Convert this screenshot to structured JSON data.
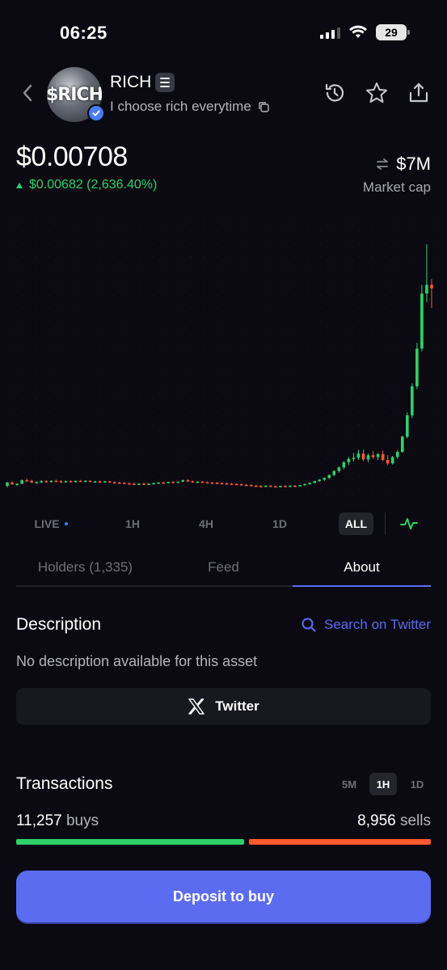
{
  "status_bar": {
    "time": "06:25",
    "battery": "29"
  },
  "header": {
    "avatar_text": "$RICH",
    "token_name": "RICH",
    "tagline": "I choose rich everytime",
    "icons": [
      "back-icon",
      "history-icon",
      "star-icon",
      "share-icon",
      "copy-icon",
      "verified-icon"
    ]
  },
  "price": {
    "value": "$0.00708",
    "change": "$0.00682 (2,636.40%)",
    "market_cap_value": "$7M",
    "market_cap_label": "Market cap"
  },
  "timeframes": {
    "items": [
      "LIVE",
      "1H",
      "4H",
      "1D",
      "ALL"
    ],
    "selected": "ALL"
  },
  "tabs": {
    "items": [
      "Holders (1,335)",
      "Feed",
      "About"
    ],
    "selected": "About"
  },
  "description": {
    "title": "Description",
    "search_label": "Search on Twitter",
    "text": "No description available for this asset",
    "twitter_label": "Twitter"
  },
  "transactions": {
    "title": "Transactions",
    "timeframes": [
      "5M",
      "1H",
      "1D"
    ],
    "selected": "1H",
    "buys_count": "11,257",
    "buys_label": "buys",
    "sells_count": "8,956",
    "sells_label": "sells",
    "buys_value": 11257,
    "sells_value": 8956
  },
  "deposit_label": "Deposit to buy",
  "colors": {
    "up": "#2fd16a",
    "down": "#ff5a2c",
    "accent": "#5b6cf0",
    "background": "#0b0a12"
  },
  "chart_data": {
    "type": "candlestick",
    "candles": [
      [
        0.00026,
        0.0004,
        0.00022,
        0.00038
      ],
      [
        0.00038,
        0.00042,
        0.0003,
        0.00032
      ],
      [
        0.00032,
        0.00036,
        0.00026,
        0.00034
      ],
      [
        0.00034,
        0.00048,
        0.00032,
        0.00046
      ],
      [
        0.00046,
        0.00052,
        0.0004,
        0.00044
      ],
      [
        0.00044,
        0.00048,
        0.00036,
        0.00038
      ],
      [
        0.00038,
        0.00042,
        0.00034,
        0.0004
      ],
      [
        0.0004,
        0.00046,
        0.00036,
        0.00043
      ],
      [
        0.00043,
        0.00046,
        0.00038,
        0.00041
      ],
      [
        0.00041,
        0.00046,
        0.00038,
        0.00044
      ],
      [
        0.00044,
        0.00048,
        0.0004,
        0.00042
      ],
      [
        0.00042,
        0.00046,
        0.00038,
        0.0004
      ],
      [
        0.0004,
        0.00045,
        0.00038,
        0.00043
      ],
      [
        0.00043,
        0.00046,
        0.0004,
        0.00041
      ],
      [
        0.00041,
        0.00045,
        0.00038,
        0.00044
      ],
      [
        0.00044,
        0.00047,
        0.0004,
        0.00042
      ],
      [
        0.00042,
        0.00046,
        0.00039,
        0.00044
      ],
      [
        0.00044,
        0.00046,
        0.0004,
        0.00041
      ],
      [
        0.00041,
        0.00044,
        0.00038,
        0.00042
      ],
      [
        0.00042,
        0.00045,
        0.00039,
        0.0004
      ],
      [
        0.0004,
        0.00044,
        0.00038,
        0.00042
      ],
      [
        0.00042,
        0.00044,
        0.00038,
        0.00039
      ],
      [
        0.00039,
        0.00042,
        0.00036,
        0.00038
      ],
      [
        0.00038,
        0.00041,
        0.00035,
        0.00037
      ],
      [
        0.00037,
        0.0004,
        0.00034,
        0.00035
      ],
      [
        0.00035,
        0.00038,
        0.00032,
        0.00034
      ],
      [
        0.00034,
        0.00037,
        0.00031,
        0.00033
      ],
      [
        0.00033,
        0.00036,
        0.0003,
        0.00034
      ],
      [
        0.00034,
        0.00037,
        0.00031,
        0.00033
      ],
      [
        0.00033,
        0.00036,
        0.0003,
        0.00034
      ],
      [
        0.00034,
        0.00038,
        0.00032,
        0.00036
      ],
      [
        0.00036,
        0.0004,
        0.00034,
        0.00038
      ],
      [
        0.00038,
        0.00042,
        0.00036,
        0.00037
      ],
      [
        0.00037,
        0.00041,
        0.00035,
        0.0004
      ],
      [
        0.0004,
        0.00043,
        0.00037,
        0.00038
      ],
      [
        0.00038,
        0.00042,
        0.00036,
        0.00041
      ],
      [
        0.00041,
        0.00048,
        0.00039,
        0.00046
      ],
      [
        0.00046,
        0.0005,
        0.0004,
        0.00042
      ],
      [
        0.00042,
        0.00045,
        0.00038,
        0.0004
      ],
      [
        0.0004,
        0.00043,
        0.00037,
        0.00041
      ],
      [
        0.00041,
        0.00044,
        0.00038,
        0.00039
      ],
      [
        0.00039,
        0.00042,
        0.00036,
        0.00038
      ],
      [
        0.00038,
        0.00041,
        0.00035,
        0.00037
      ],
      [
        0.00037,
        0.0004,
        0.00034,
        0.00036
      ],
      [
        0.00036,
        0.00039,
        0.00033,
        0.00035
      ],
      [
        0.00035,
        0.00038,
        0.00032,
        0.00034
      ],
      [
        0.00034,
        0.00037,
        0.00031,
        0.00033
      ],
      [
        0.00033,
        0.00036,
        0.0003,
        0.00032
      ],
      [
        0.00032,
        0.00035,
        0.00029,
        0.0003
      ],
      [
        0.0003,
        0.00033,
        0.00027,
        0.00029
      ],
      [
        0.00029,
        0.00032,
        0.00026,
        0.00027
      ],
      [
        0.00027,
        0.0003,
        0.00024,
        0.00026
      ],
      [
        0.00026,
        0.00029,
        0.00023,
        0.00025
      ],
      [
        0.00025,
        0.00028,
        0.00022,
        0.00027
      ],
      [
        0.00027,
        0.0003,
        0.00024,
        0.00025
      ],
      [
        0.00025,
        0.00028,
        0.00022,
        0.00024
      ],
      [
        0.00024,
        0.00027,
        0.00021,
        0.00026
      ],
      [
        0.00026,
        0.00029,
        0.00023,
        0.00025
      ],
      [
        0.00025,
        0.00028,
        0.00022,
        0.00027
      ],
      [
        0.00027,
        0.0003,
        0.00024,
        0.00026
      ],
      [
        0.00026,
        0.0003,
        0.00024,
        0.00029
      ],
      [
        0.00029,
        0.00034,
        0.00027,
        0.00033
      ],
      [
        0.00033,
        0.00038,
        0.0003,
        0.00037
      ],
      [
        0.00037,
        0.00044,
        0.00035,
        0.00043
      ],
      [
        0.00043,
        0.0005,
        0.0004,
        0.00048
      ],
      [
        0.00048,
        0.00056,
        0.00044,
        0.00054
      ],
      [
        0.00054,
        0.00066,
        0.0005,
        0.00064
      ],
      [
        0.00064,
        0.0008,
        0.0006,
        0.00078
      ],
      [
        0.00078,
        0.00094,
        0.00072,
        0.0009
      ],
      [
        0.0009,
        0.00112,
        0.00084,
        0.00108
      ],
      [
        0.00108,
        0.00126,
        0.00098,
        0.0012
      ],
      [
        0.0012,
        0.0014,
        0.0011,
        0.00124
      ],
      [
        0.00124,
        0.0015,
        0.00116,
        0.00138
      ],
      [
        0.00138,
        0.00152,
        0.00112,
        0.00118
      ],
      [
        0.00118,
        0.00138,
        0.00108,
        0.00132
      ],
      [
        0.00132,
        0.00146,
        0.0012,
        0.00126
      ],
      [
        0.00126,
        0.0014,
        0.00116,
        0.00136
      ],
      [
        0.00136,
        0.00148,
        0.00112,
        0.00116
      ],
      [
        0.00116,
        0.00132,
        0.00098,
        0.00104
      ],
      [
        0.00104,
        0.0013,
        0.001,
        0.00126
      ],
      [
        0.00126,
        0.0015,
        0.0012,
        0.00144
      ],
      [
        0.00144,
        0.002,
        0.0014,
        0.00196
      ],
      [
        0.00196,
        0.0028,
        0.0019,
        0.0027
      ],
      [
        0.0027,
        0.0038,
        0.0026,
        0.0037
      ],
      [
        0.0037,
        0.0052,
        0.0036,
        0.005
      ],
      [
        0.005,
        0.0072,
        0.0049,
        0.0069
      ],
      [
        0.0069,
        0.0086,
        0.0066,
        0.0072
      ],
      [
        0.0072,
        0.0074,
        0.0064,
        0.00708
      ]
    ],
    "ylim": [
      0.0001,
      0.0088
    ],
    "grid": true
  }
}
